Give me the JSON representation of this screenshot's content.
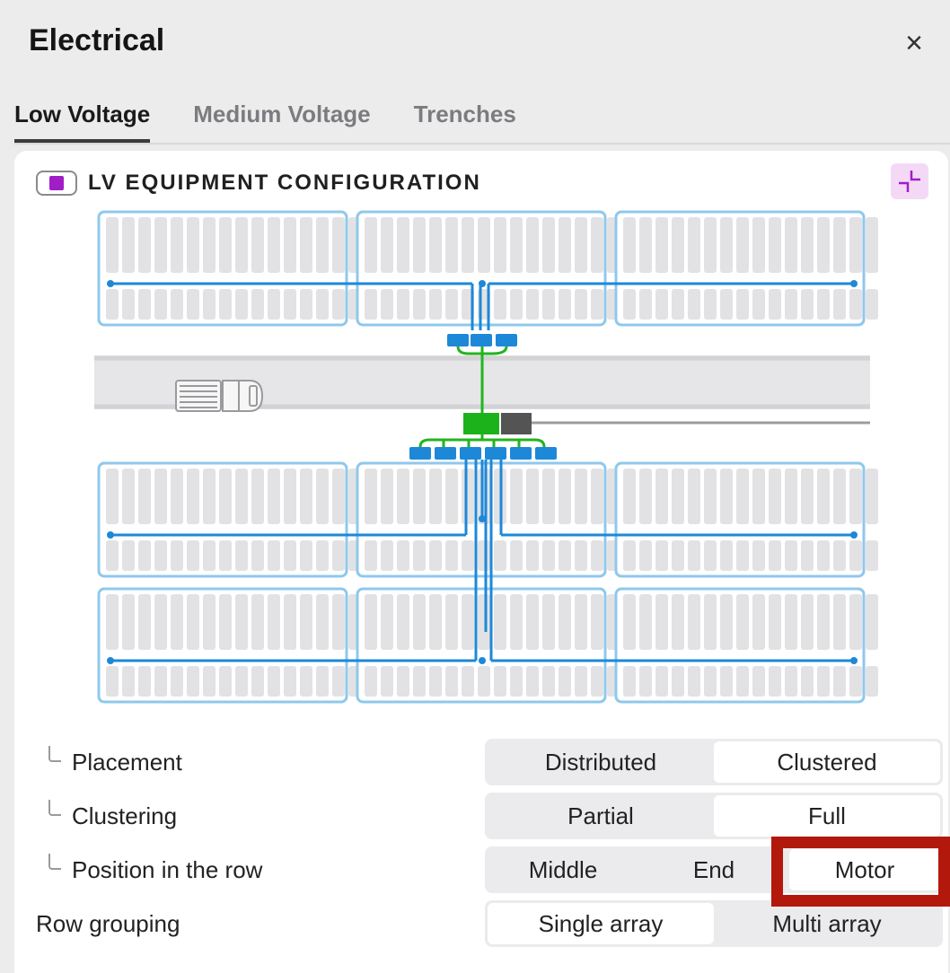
{
  "panel": {
    "title": "Electrical",
    "close_glyph": "×"
  },
  "tabs": [
    {
      "label": "Low Voltage",
      "active": true
    },
    {
      "label": "Medium Voltage",
      "active": false
    },
    {
      "label": "Trenches",
      "active": false
    }
  ],
  "card": {
    "title": "LV EQUIPMENT CONFIGURATION",
    "toggle_color": "#a11ec6",
    "collapse_icon": "collapse-icon"
  },
  "options": {
    "placement": {
      "label": "Placement",
      "choices": [
        "Distributed",
        "Clustered"
      ],
      "selected": "Clustered"
    },
    "clustering": {
      "label": "Clustering",
      "choices": [
        "Partial",
        "Full"
      ],
      "selected": "Full"
    },
    "position": {
      "label": "Position in the row",
      "choices": [
        "Middle",
        "End",
        "Motor"
      ],
      "selected": "Motor"
    },
    "row_grouping": {
      "label": "Row grouping",
      "choices": [
        "Single array",
        "Multi array"
      ],
      "selected": "Single array"
    }
  },
  "colors": {
    "accent": "#a11ec6",
    "highlight": "#b3180c",
    "cable_blue": "#1e88d8",
    "cable_green": "#22b41e",
    "table_outline": "#8fc8ec",
    "module_fill": "#e2e2e4"
  }
}
